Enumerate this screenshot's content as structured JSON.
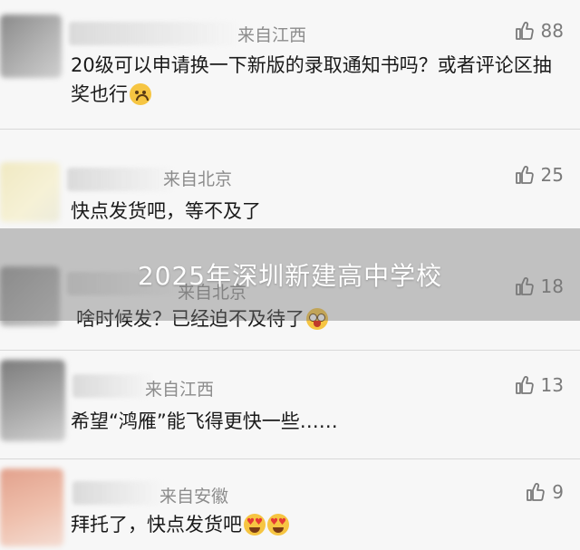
{
  "comments": [
    {
      "location": "来自江西",
      "likes": "88",
      "text": "20级可以申请换一下新版的录取通知书吗？或者评论区抽奖也行",
      "emoji": "sad-face-emoji"
    },
    {
      "location": "来自北京",
      "likes": "25",
      "text": "快点发货吧，等不及了"
    },
    {
      "location": "来自北京",
      "likes": "18",
      "text": "啥时候发？已经迫不及待了",
      "emoji": "drooling-face-emoji"
    },
    {
      "location": "来自江西",
      "likes": "13",
      "text": "希望“鸿雁”能飞得更快一些……"
    },
    {
      "location": "来自安徽",
      "likes": "9",
      "text": "拜托了，快点发货吧",
      "emoji": "heart-eyes-emoji"
    }
  ],
  "overlay": {
    "caption": "2025年深圳新建高中学校"
  },
  "icons": {
    "like": "thumbs-up-icon"
  },
  "colors": {
    "background": "#f7f7f7",
    "text": "#1a1a1a",
    "meta": "#8c8c8c",
    "banner_text": "#ffffff"
  }
}
